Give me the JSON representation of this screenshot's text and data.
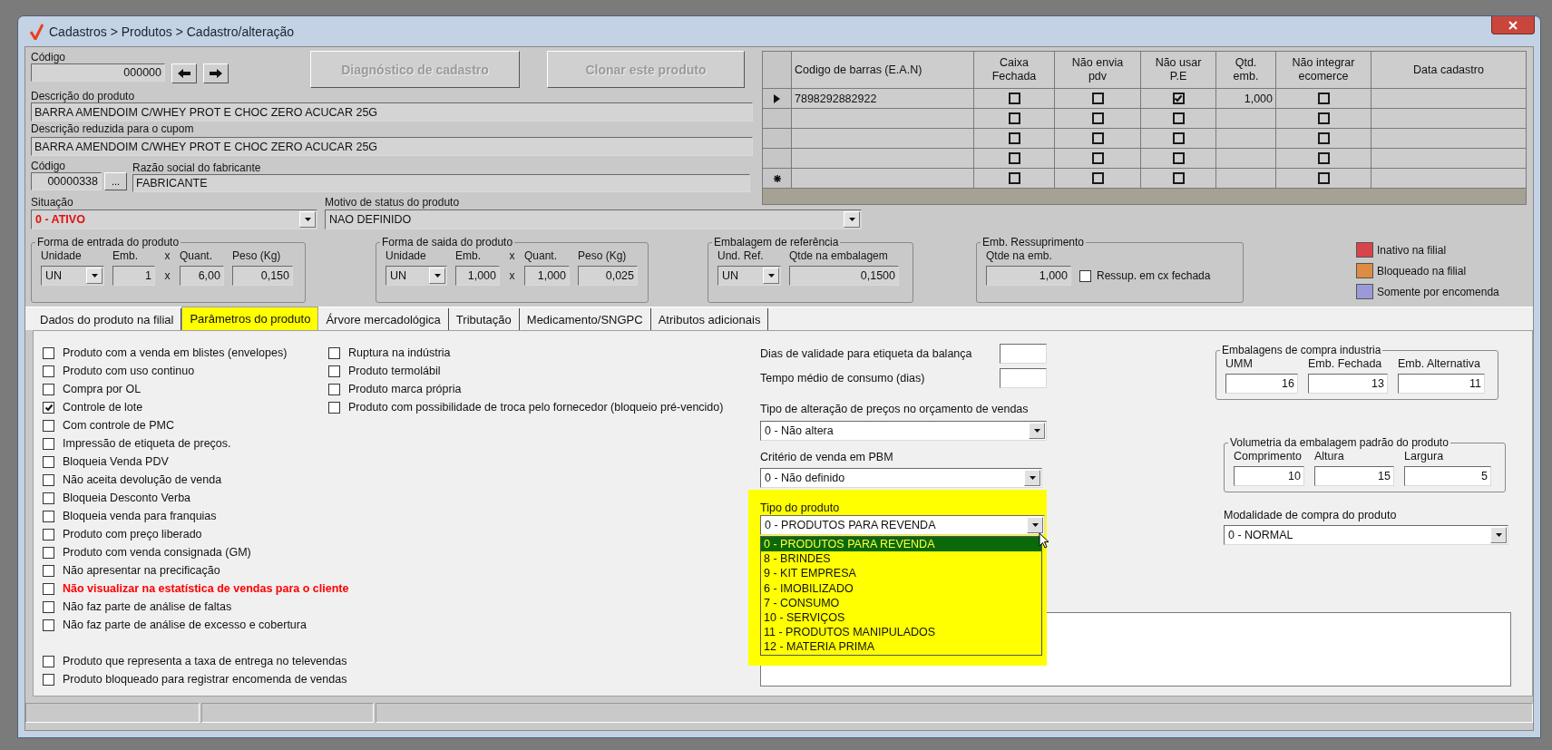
{
  "window": {
    "title": "Cadastros > Produtos > Cadastro/alteração"
  },
  "codigo": {
    "label": "Código",
    "value": "000000"
  },
  "actions": [
    {
      "label": "Diagnóstico de cadastro",
      "disabled": true
    },
    {
      "label": "Clonar este produto",
      "disabled": true
    }
  ],
  "descricao": {
    "label": "Descrição  do produto",
    "value": "BARRA AMENDOIM C/WHEY PROT E CHOC ZERO ACUCAR 25G"
  },
  "descricao_reduzida": {
    "label": "Descrição reduzida para o cupom",
    "value": "BARRA AMENDOIM C/WHEY PROT E CHOC ZERO ACUCAR 25G"
  },
  "fabricante": {
    "code_label": "Código",
    "code": "00000338",
    "browse_label": "...",
    "name_label": "Razão social do fabricante",
    "name": "FABRICANTE"
  },
  "situacao": {
    "label": "Situação",
    "value": "0 - ATIVO"
  },
  "motivo": {
    "label": "Motivo de status do produto",
    "value": "NAO DEFINIDO"
  },
  "groups": [
    {
      "title": "Forma de entrada do produto",
      "fields": [
        {
          "kind": "select",
          "label": "Unidade",
          "value": "UN"
        },
        {
          "kind": "text",
          "label": "Emb.",
          "value": "1"
        },
        {
          "kind": "sep",
          "label": "x",
          "value": "x"
        },
        {
          "kind": "text",
          "label": "Quant.",
          "value": "6,00"
        },
        {
          "kind": "text",
          "label": "Peso (Kg)",
          "value": "0,150"
        }
      ]
    },
    {
      "title": "Forma de saida do produto",
      "fields": [
        {
          "kind": "select",
          "label": "Unidade",
          "value": "UN"
        },
        {
          "kind": "text",
          "label": "Emb.",
          "value": "1,000"
        },
        {
          "kind": "sep",
          "label": "x",
          "value": "x"
        },
        {
          "kind": "text",
          "label": "Quant.",
          "value": "1,000"
        },
        {
          "kind": "text",
          "label": "Peso (Kg)",
          "value": "0,025"
        }
      ]
    },
    {
      "title": "Embalagem de referência",
      "fields": [
        {
          "kind": "select",
          "label": "Und. Ref.",
          "value": "UN"
        },
        {
          "kind": "text",
          "label": "Qtde na embalagem",
          "value": "0,1500"
        }
      ]
    },
    {
      "title": "Emb. Ressuprimento",
      "fields": [
        {
          "kind": "text",
          "label": "Qtde na emb.",
          "value": "1,000"
        },
        {
          "kind": "check",
          "label": "Ressup. em cx fechada",
          "checked": false
        }
      ]
    }
  ],
  "legend": [
    {
      "label": "Inativo na filial",
      "color": "#d9434b"
    },
    {
      "label": "Bloqueado na filial",
      "color": "#dd8c44"
    },
    {
      "label": "Somente por encomenda",
      "color": "#9a9ad8"
    }
  ],
  "barcodes": {
    "columns": [
      "Codigo de barras (E.A.N)",
      "Caixa\nFechada",
      "Não envia\npdv",
      "Não usar\nP.E",
      "Qtd.\nemb.",
      "Não integrar\necomerce",
      "Data cadastro"
    ],
    "rows": [
      {
        "kind": "current",
        "ean": "7898292882922",
        "caixa_fechada": false,
        "nao_envia_pdv": false,
        "nao_usar_pe": true,
        "qtd": "1,000",
        "nao_integrar": false
      },
      {
        "kind": "blank",
        "caixa_fechada": false,
        "nao_envia_pdv": false,
        "nao_usar_pe": false,
        "nao_integrar": false
      },
      {
        "kind": "blank",
        "caixa_fechada": false,
        "nao_envia_pdv": false,
        "nao_usar_pe": false,
        "nao_integrar": false
      },
      {
        "kind": "blank",
        "caixa_fechada": false,
        "nao_envia_pdv": false,
        "nao_usar_pe": false,
        "nao_integrar": false
      },
      {
        "kind": "new",
        "caixa_fechada": false,
        "nao_envia_pdv": false,
        "nao_usar_pe": false,
        "nao_integrar": false
      }
    ]
  },
  "tabs": [
    {
      "label": "Dados do produto na filial",
      "selected": false,
      "highlighted": false
    },
    {
      "label": "Parâmetros do produto",
      "selected": true,
      "highlighted": true
    },
    {
      "label": "Árvore mercadológica",
      "selected": false,
      "highlighted": false
    },
    {
      "label": "Tributação",
      "selected": false,
      "highlighted": false
    },
    {
      "label": "Medicamento/SNGPC",
      "selected": false,
      "highlighted": false
    },
    {
      "label": "Atributos adicionais",
      "selected": false,
      "highlighted": false
    }
  ],
  "options_col1": [
    {
      "label": "Produto com a venda em blistes (envelopes)",
      "checked": false,
      "kind": "normal"
    },
    {
      "label": "Produto com uso continuo",
      "checked": false,
      "kind": "normal"
    },
    {
      "label": "Compra por OL",
      "checked": false,
      "kind": "normal"
    },
    {
      "label": "Controle de lote",
      "checked": true,
      "kind": "normal"
    },
    {
      "label": "Com controle de PMC",
      "checked": false,
      "kind": "normal"
    },
    {
      "label": "Impressão de etiqueta de preços.",
      "checked": false,
      "kind": "normal"
    },
    {
      "label": "Bloqueia Venda PDV",
      "checked": false,
      "kind": "normal"
    },
    {
      "label": "Não aceita devolução de venda",
      "checked": false,
      "kind": "normal"
    },
    {
      "label": "Bloqueia Desconto Verba",
      "checked": false,
      "kind": "normal"
    },
    {
      "label": "Bloqueia venda para franquias",
      "checked": false,
      "kind": "normal"
    },
    {
      "label": "Produto com preço liberado",
      "checked": false,
      "kind": "normal"
    },
    {
      "label": "Produto com venda consignada (GM)",
      "checked": false,
      "kind": "normal"
    },
    {
      "label": "Não apresentar na precificação",
      "checked": false,
      "kind": "normal"
    },
    {
      "label": "Não visualizar na estatística de vendas para o cliente",
      "checked": false,
      "kind": "alert"
    },
    {
      "label": "Não faz parte de análise de faltas",
      "checked": false,
      "kind": "normal"
    },
    {
      "label": "Não faz parte de análise de excesso e cobertura",
      "checked": false,
      "kind": "normal"
    }
  ],
  "options_col1_bottom": [
    {
      "label": "Produto que representa a taxa de entrega no televendas",
      "checked": false,
      "kind": "normal"
    },
    {
      "label": "Produto bloqueado para registrar encomenda de vendas",
      "checked": false,
      "kind": "normal"
    }
  ],
  "options_col2": [
    {
      "label": "Ruptura na indústria",
      "checked": false,
      "kind": "normal"
    },
    {
      "label": "Produto termolábil",
      "checked": false,
      "kind": "normal"
    },
    {
      "label": "Produto marca própria",
      "checked": false,
      "kind": "normal"
    },
    {
      "label": "Produto com possibilidade de troca pelo fornecedor (bloqueio pré-vencido)",
      "checked": false,
      "kind": "normal"
    }
  ],
  "validade": {
    "label": "Dias de validade para etiqueta da balança"
  },
  "tempo": {
    "label": "Tempo médio de consumo (dias)"
  },
  "alteracao_precos": {
    "label": "Tipo de alteração de preços no orçamento de vendas",
    "value": "0 - Não altera"
  },
  "criterio_pbm": {
    "label": "Critério de venda em PBM",
    "value": "0 - Não definido"
  },
  "tipo_produto": {
    "label": "Tipo do produto",
    "value": "0 - PRODUTOS PARA REVENDA",
    "open": true,
    "highlighted": true,
    "options": [
      {
        "label": "0 - PRODUTOS PARA REVENDA",
        "selected": true
      },
      {
        "label": "8 - BRINDES",
        "selected": false
      },
      {
        "label": "9 - KIT EMPRESA",
        "selected": false
      },
      {
        "label": "6 - IMOBILIZADO",
        "selected": false
      },
      {
        "label": "7 - CONSUMO",
        "selected": false
      },
      {
        "label": "10 - SERVIÇOS",
        "selected": false
      },
      {
        "label": "11 - PRODUTOS MANIPULADOS",
        "selected": false
      },
      {
        "label": "12 - MATERIA PRIMA",
        "selected": false
      }
    ]
  },
  "embalagens_compra": {
    "title": "Embalagens de compra industria",
    "fields": [
      {
        "label": "UMM",
        "value": "16"
      },
      {
        "label": "Emb. Fechada",
        "value": "13"
      },
      {
        "label": "Emb. Alternativa",
        "value": "11"
      }
    ]
  },
  "volumetria": {
    "title": "Volumetria da embalagem padrão do produto",
    "fields": [
      {
        "label": "Comprimento",
        "value": "10"
      },
      {
        "label": "Altura",
        "value": "15"
      },
      {
        "label": "Largura",
        "value": "5"
      }
    ]
  },
  "modalidade": {
    "label": "Modalidade de compra do produto",
    "value": "0 - NORMAL"
  }
}
